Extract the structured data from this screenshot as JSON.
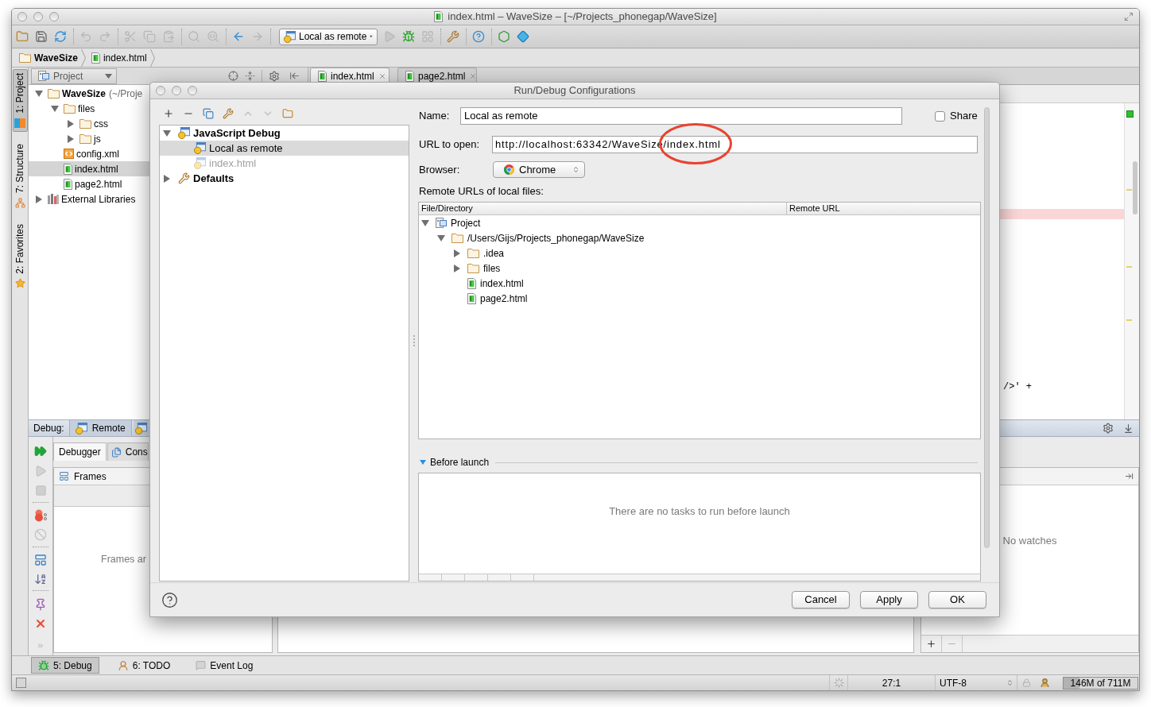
{
  "window": {
    "title": "index.html – WaveSize – [~/Projects_phonegap/WaveSize]"
  },
  "toolbar": {
    "run_configuration": "Local as remote"
  },
  "breadcrumb": [
    {
      "label": "WaveSize",
      "kind": "project"
    },
    {
      "label": "index.html",
      "kind": "html"
    }
  ],
  "tool_stripe": [
    {
      "label": "1: Project",
      "kind": "project",
      "selected": true
    },
    {
      "label": "7: Structure",
      "kind": "structure",
      "selected": false
    },
    {
      "label": "2: Favorites",
      "kind": "favorites",
      "selected": false
    }
  ],
  "project_panel": {
    "title": "Project",
    "tree": [
      {
        "label": "WaveSize",
        "location": "(~/Proje",
        "kind": "project",
        "expanded": true,
        "selected": false,
        "children": [
          {
            "label": "files",
            "kind": "folder",
            "expanded": true,
            "selected": false,
            "children": [
              {
                "label": "css",
                "kind": "folder",
                "expanded": false,
                "selected": false
              },
              {
                "label": "js",
                "kind": "folder",
                "expanded": false,
                "selected": false
              }
            ]
          },
          {
            "label": "config.xml",
            "kind": "xml",
            "selected": false
          },
          {
            "label": "index.html",
            "kind": "html",
            "selected": true
          },
          {
            "label": "page2.html",
            "kind": "html",
            "selected": false
          }
        ]
      },
      {
        "label": "External Libraries",
        "kind": "library",
        "expanded": false,
        "selected": false
      }
    ]
  },
  "editor": {
    "tabs": [
      {
        "label": "index.html",
        "selected": true
      },
      {
        "label": "page2.html",
        "selected": false
      }
    ],
    "code_fragment": "/>' +"
  },
  "debug_panel": {
    "label": "Debug:",
    "sessions": [
      {
        "label": "Remote"
      }
    ],
    "tabs": [
      {
        "label": "Debugger",
        "kind": "debugger",
        "selected": true
      },
      {
        "label": "Cons",
        "kind": "console",
        "selected": false
      }
    ],
    "frames": {
      "title": "Frames",
      "empty_text": "Frames ar"
    },
    "watches": {
      "empty_text": "No watches"
    }
  },
  "tool_windows": [
    {
      "label": "5: Debug",
      "kind": "debug",
      "selected": true
    },
    {
      "label": "6: TODO",
      "kind": "todo",
      "selected": false
    },
    {
      "label": "Event Log",
      "kind": "log",
      "selected": false
    }
  ],
  "status_bar": {
    "position": "27:1",
    "encoding": "UTF-8",
    "memory": {
      "label": "146M of 711M",
      "level": 0.21
    }
  },
  "dialog": {
    "title": "Run/Debug Configurations",
    "configurations": [
      {
        "label": "JavaScript Debug",
        "kind": "category",
        "expanded": true,
        "selected": false,
        "children": [
          {
            "label": "Local as remote",
            "kind": "configuration",
            "selected": true
          },
          {
            "label": "index.html",
            "kind": "temporary",
            "selected": false
          }
        ]
      },
      {
        "label": "Defaults",
        "kind": "defaults",
        "expanded": false,
        "selected": false
      }
    ],
    "name_field": {
      "label": "Name:",
      "value": "Local as remote"
    },
    "share": {
      "label": "Share",
      "checked": false
    },
    "url_field": {
      "label": "URL to open:",
      "value": "http://localhost:63342/WaveSize/index.html"
    },
    "browser": {
      "label": "Browser:",
      "value": "Chrome"
    },
    "remote_urls": {
      "label": "Remote URLs of local files:",
      "columns": [
        "File/Directory",
        "Remote URL"
      ],
      "tree": [
        {
          "label": "Project",
          "kind": "module",
          "expanded": true,
          "selected": false,
          "children": [
            {
              "label": "/Users/Gijs/Projects_phonegap/WaveSize",
              "kind": "folder",
              "expanded": true,
              "selected": false,
              "children": [
                {
                  "label": ".idea",
                  "kind": "folder",
                  "expanded": false,
                  "selected": false
                },
                {
                  "label": "files",
                  "kind": "folder",
                  "expanded": false,
                  "selected": false
                },
                {
                  "label": "index.html",
                  "kind": "html",
                  "selected": false
                },
                {
                  "label": "page2.html",
                  "kind": "html",
                  "selected": false
                }
              ]
            }
          ]
        }
      ]
    },
    "before_launch": {
      "label": "Before launch",
      "expanded": true,
      "empty_text": "There are no tasks to run before launch"
    },
    "buttons": [
      "Cancel",
      "Apply",
      "OK"
    ]
  }
}
